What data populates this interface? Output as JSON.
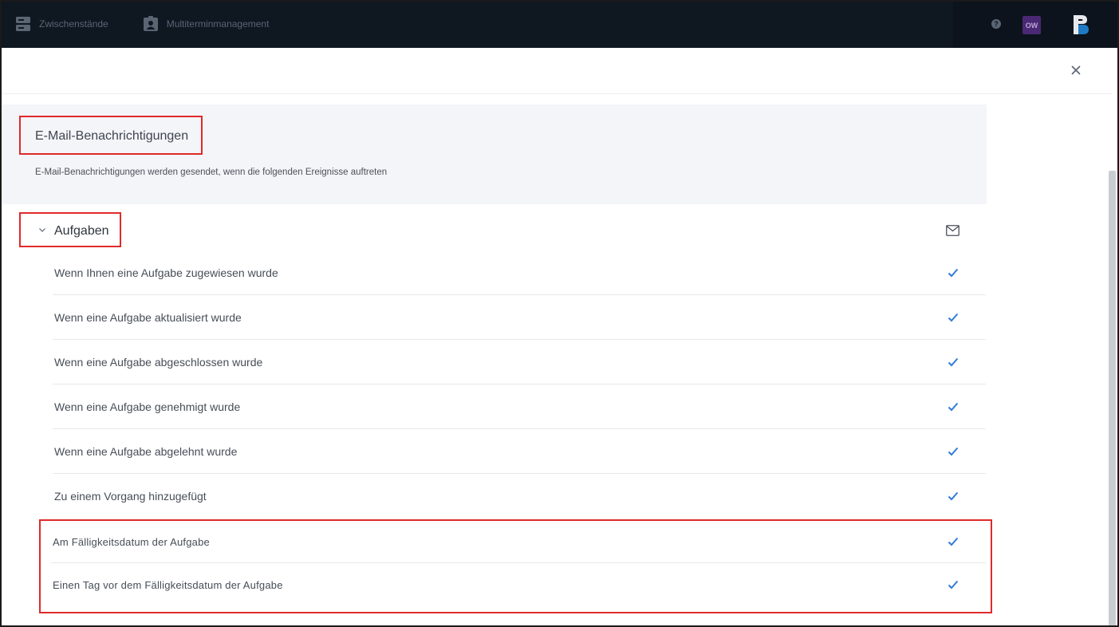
{
  "topbar": {
    "nav": [
      {
        "label": "Zwischenstände",
        "icon": "server-icon"
      },
      {
        "label": "Multiterminmanagement",
        "icon": "contact-card-icon"
      }
    ],
    "help_icon": "help-icon",
    "user_initials": "OW",
    "logo_icon": "brand-logo-icon"
  },
  "close_icon": "close-icon",
  "info": {
    "title": "E-Mail-Benachrichtigungen",
    "description": "E-Mail-Benachrichtigungen werden gesendet, wenn die folgenden Ereignisse auftreten"
  },
  "section": {
    "title": "Aufgaben",
    "expanded": true,
    "column_icon": "mail-icon",
    "rows": [
      {
        "label": "Wenn Ihnen eine Aufgabe zugewiesen wurde",
        "checked": true
      },
      {
        "label": "Wenn eine Aufgabe aktualisiert wurde",
        "checked": true
      },
      {
        "label": "Wenn eine Aufgabe abgeschlossen wurde",
        "checked": true
      },
      {
        "label": "Wenn eine Aufgabe genehmigt wurde",
        "checked": true
      },
      {
        "label": "Wenn eine Aufgabe abgelehnt wurde",
        "checked": true
      },
      {
        "label": "Zu einem Vorgang hinzugefügt",
        "checked": true
      },
      {
        "label": "Am Fälligkeitsdatum der Aufgabe",
        "checked": true
      },
      {
        "label": "Einen Tag vor dem Fälligkeitsdatum der Aufgabe",
        "checked": true
      }
    ]
  },
  "colors": {
    "topbar": "#0f1721",
    "accent_check": "#2f7bd9",
    "highlight": "#e02a2a",
    "panel_bg": "#f4f5f8"
  }
}
